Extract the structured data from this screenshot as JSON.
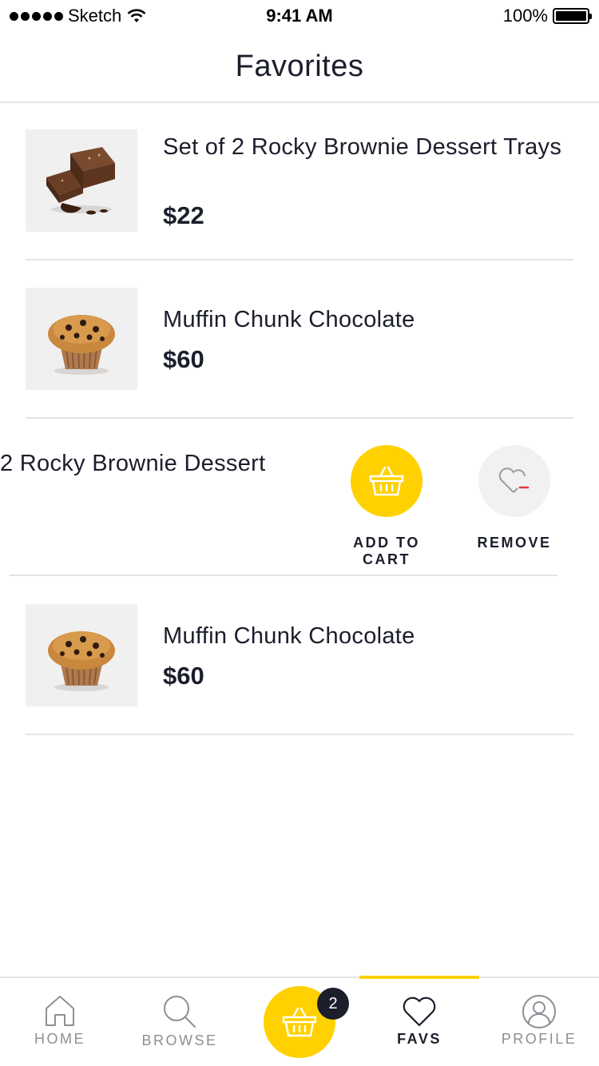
{
  "status_bar": {
    "carrier": "Sketch",
    "time": "9:41 AM",
    "battery": "100%"
  },
  "nav": {
    "title": "Favorites"
  },
  "items": [
    {
      "name": "Set of 2 Rocky Brownie Dessert Trays",
      "price": "$22",
      "image": "brownie"
    },
    {
      "name": "Muffin Chunk Chocolate",
      "price": "$60",
      "image": "muffin"
    },
    {
      "name": "2 Rocky Brownie Dessert",
      "image": "brownie"
    },
    {
      "name": "Muffin Chunk Chocolate",
      "price": "$60",
      "image": "muffin"
    }
  ],
  "swipe_actions": {
    "add_to_cart": "ADD TO CART",
    "remove": "REMOVE"
  },
  "tabbar": {
    "home": "HOME",
    "browse": "BROWSE",
    "favs": "FAVS",
    "profile": "PROFILE",
    "cart_badge": "2",
    "active": "favs"
  },
  "colors": {
    "accent": "#ffd100",
    "text": "#1b1e2b",
    "muted": "#8d8f96",
    "divider": "#e4e4e6",
    "remove_red": "#e53935"
  }
}
